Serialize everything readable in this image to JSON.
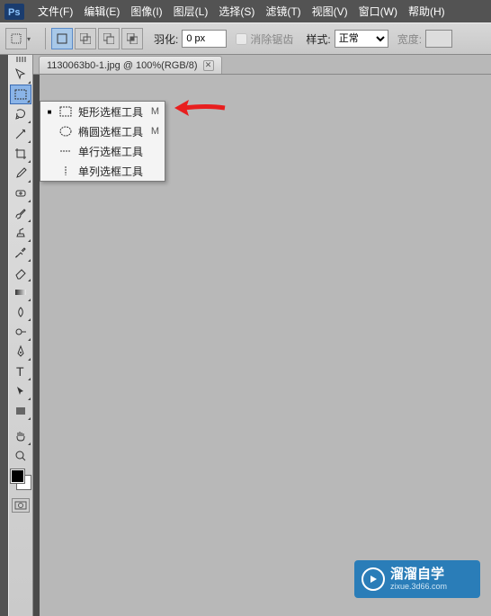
{
  "menubar": {
    "items": [
      "文件(F)",
      "编辑(E)",
      "图像(I)",
      "图层(L)",
      "选择(S)",
      "滤镜(T)",
      "视图(V)",
      "窗口(W)",
      "帮助(H)"
    ]
  },
  "optionsbar": {
    "feather_label": "羽化:",
    "feather_value": "0 px",
    "antialias_label": "消除锯齿",
    "style_label": "样式:",
    "style_value": "正常",
    "width_label": "宽度:"
  },
  "document": {
    "tab_title": "1130063b0-1.jpg @ 100%(RGB/8)"
  },
  "toolbox": {
    "tools": [
      {
        "name": "move-tool"
      },
      {
        "name": "rectangular-marquee-tool",
        "selected": true
      },
      {
        "name": "lasso-tool"
      },
      {
        "name": "magic-wand-tool"
      },
      {
        "name": "crop-tool"
      },
      {
        "name": "eyedropper-tool"
      },
      {
        "name": "healing-brush-tool"
      },
      {
        "name": "brush-tool"
      },
      {
        "name": "clone-stamp-tool"
      },
      {
        "name": "history-brush-tool"
      },
      {
        "name": "eraser-tool"
      },
      {
        "name": "gradient-tool"
      },
      {
        "name": "smudge-tool"
      },
      {
        "name": "dodge-tool"
      },
      {
        "name": "pen-tool"
      },
      {
        "name": "type-tool"
      },
      {
        "name": "path-selection-tool"
      },
      {
        "name": "rectangle-shape-tool"
      },
      {
        "name": "hand-tool"
      },
      {
        "name": "zoom-tool"
      }
    ]
  },
  "flyout": {
    "items": [
      {
        "label": "矩形选框工具",
        "shortcut": "M",
        "selected": true,
        "icon": "rect"
      },
      {
        "label": "椭圆选框工具",
        "shortcut": "M",
        "selected": false,
        "icon": "ellipse"
      },
      {
        "label": "单行选框工具",
        "shortcut": "",
        "selected": false,
        "icon": "row"
      },
      {
        "label": "单列选框工具",
        "shortcut": "",
        "selected": false,
        "icon": "col"
      }
    ]
  },
  "watermark": {
    "title": "溜溜自学",
    "sub": "zixue.3d66.com"
  },
  "colors": {
    "accent": "#2a7db8",
    "arrow": "#e81e1e"
  }
}
